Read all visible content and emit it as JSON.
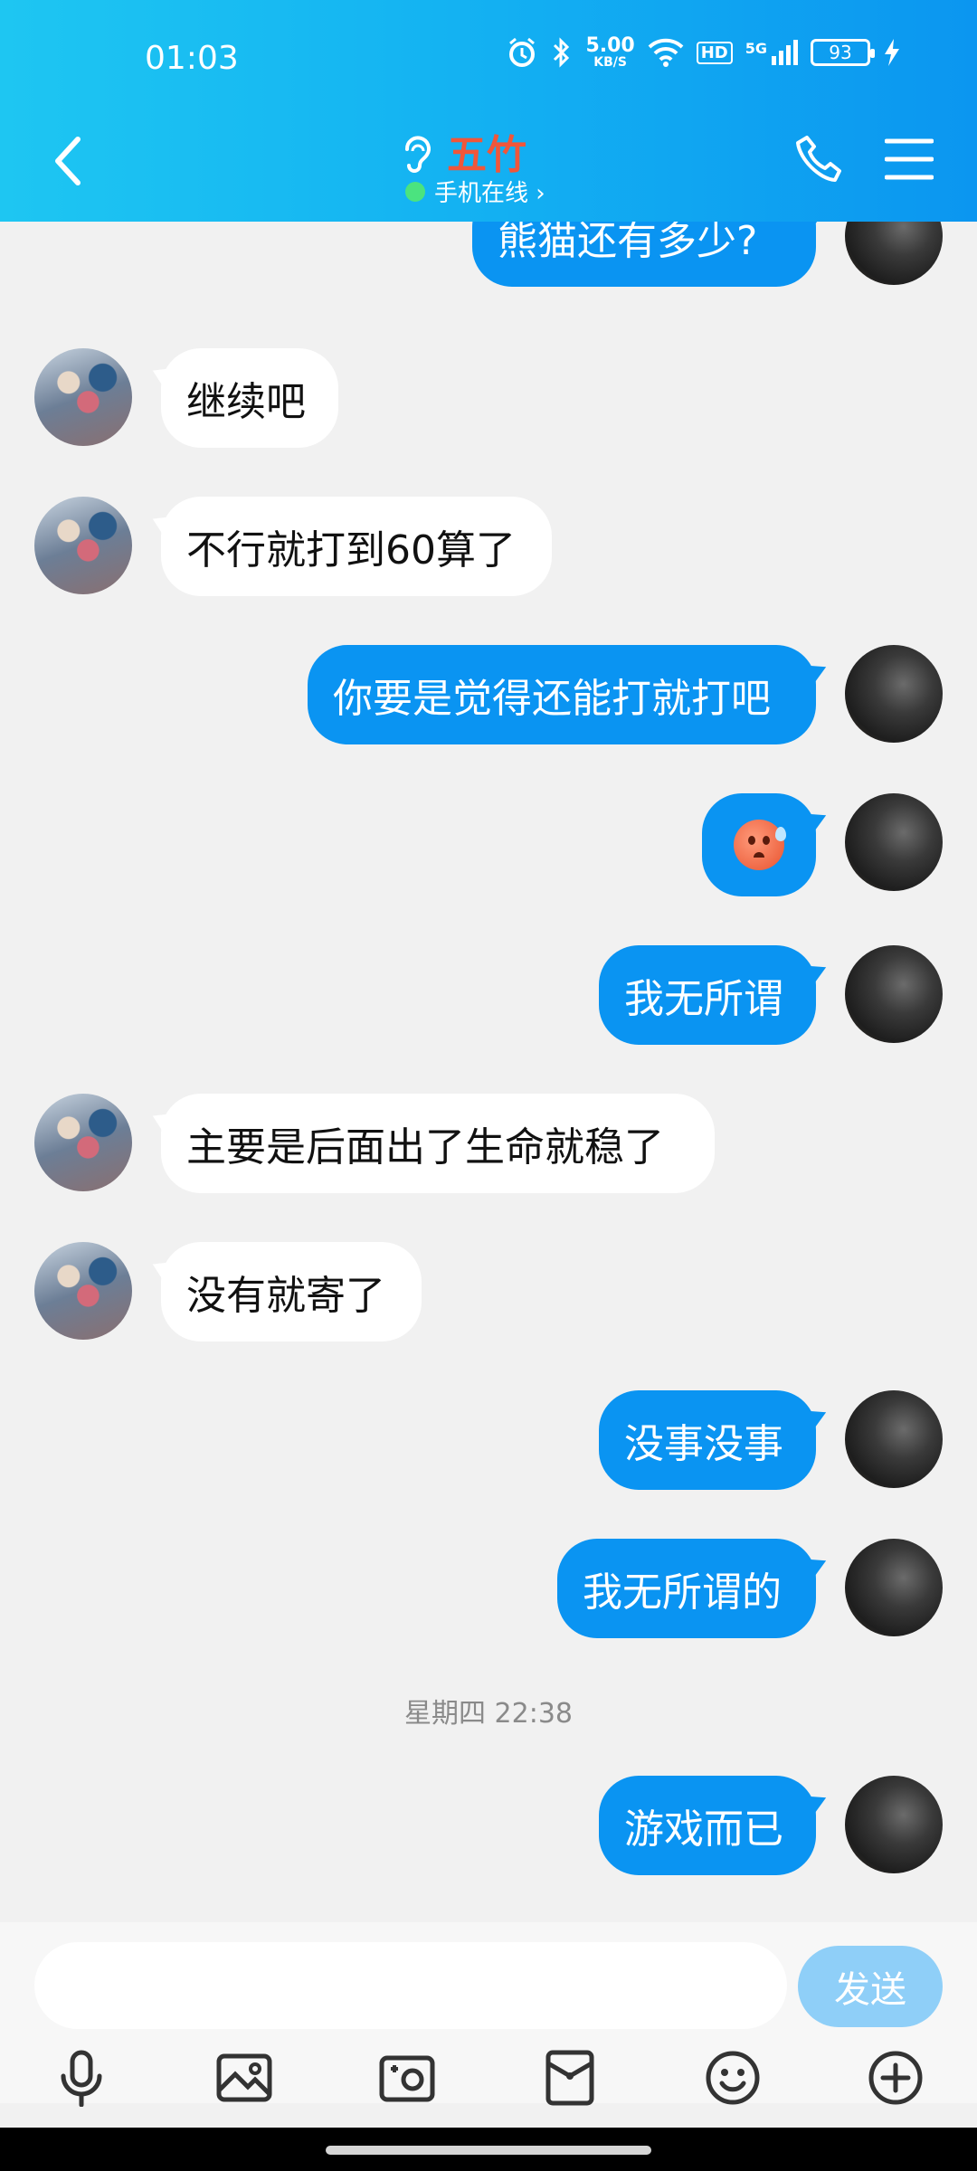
{
  "status_bar": {
    "time": "01:03",
    "net_speed": "5.00",
    "net_unit": "KB/S",
    "hd": "HD",
    "signal": "5G",
    "battery": "93"
  },
  "header": {
    "contact_name": "五竹",
    "online_status": "手机在线 ›"
  },
  "messages": [
    {
      "side": "out",
      "text": "熊猫还有多少?"
    },
    {
      "side": "in",
      "text": "继续吧"
    },
    {
      "side": "in",
      "text": "不行就打到60算了"
    },
    {
      "side": "out",
      "text": "你要是觉得还能打就打吧"
    },
    {
      "side": "out",
      "emoji": "sweat-face-emoji"
    },
    {
      "side": "out",
      "text": "我无所谓"
    },
    {
      "side": "in",
      "text": "主要是后面出了生命就稳了"
    },
    {
      "side": "in",
      "text": "没有就寄了"
    },
    {
      "side": "out",
      "text": "没事没事"
    },
    {
      "side": "out",
      "text": "我无所谓的"
    },
    {
      "side": "out",
      "text": "游戏而已"
    }
  ],
  "timestamp": "星期四 22:38",
  "input": {
    "placeholder": "",
    "send_label": "发送"
  },
  "colors": {
    "header_start": "#1ec6f2",
    "header_end": "#0b96f0",
    "outgoing_bubble": "#0a94f2",
    "incoming_bubble": "#ffffff",
    "name_color": "#f0563a",
    "send_button": "#8fcff8"
  },
  "toolbar_icons": [
    "microphone-icon",
    "image-icon",
    "camera-icon",
    "red-packet-icon",
    "emoji-icon",
    "plus-icon"
  ]
}
